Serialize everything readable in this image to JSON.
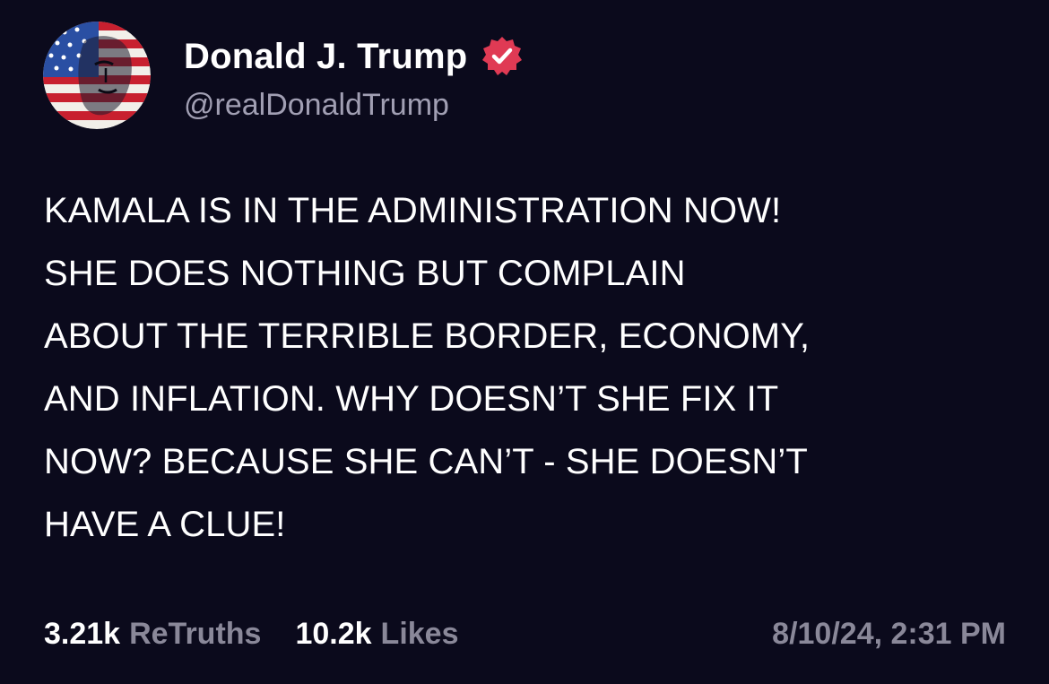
{
  "author": {
    "display_name": "Donald J. Trump",
    "handle": "@realDonaldTrump",
    "verified": true,
    "verified_color": "#e03a54",
    "avatar_icon": "flag-painted-portrait-avatar"
  },
  "post": {
    "text": "KAMALA IS IN THE ADMINISTRATION NOW!\nSHE DOES NOTHING BUT COMPLAIN\nABOUT THE TERRIBLE BORDER, ECONOMY,\nAND INFLATION. WHY DOESN’T SHE FIX IT\nNOW? BECAUSE SHE CAN’T - SHE DOESN’T\nHAVE A CLUE!"
  },
  "stats": {
    "retruths_count": "3.21k",
    "retruths_label": "ReTruths",
    "likes_count": "10.2k",
    "likes_label": "Likes"
  },
  "timestamp": "8/10/24, 2:31 PM",
  "colors": {
    "background": "#0b0a1c",
    "primary_text": "#ffffff",
    "secondary_text": "#8a8899",
    "handle_text": "#a19fb3"
  }
}
